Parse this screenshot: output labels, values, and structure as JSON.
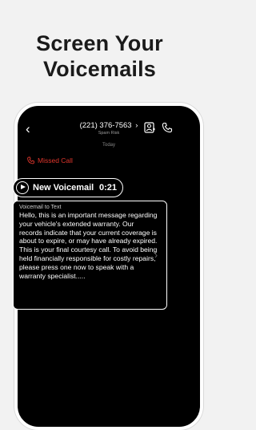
{
  "headline": {
    "line1": "Screen Your",
    "line2": "Voicemails"
  },
  "header": {
    "back_icon": "chevron-left-icon",
    "phone_number": "(221) 376-7563",
    "chevron_icon": "chevron-right-icon",
    "subtitle": "Spam Risk",
    "contact_icon": "contact-card-icon",
    "call_icon": "phone-icon"
  },
  "thread": {
    "date_label": "Today",
    "missed_call_label": "Missed Call",
    "missed_call_color": "#e0362c"
  },
  "voicemail": {
    "label": "New Voicemail",
    "duration": "0:21",
    "play_icon": "play-icon"
  },
  "transcript": {
    "label": "Voicemail to Text",
    "text": "Hello, this is an important message regarding your vehicle's extended warranty. Our records indicate that your current coverage is about to expire, or may have already expired. This is your final courtesy call. To avoid being held financially responsible for costly repairs, please press one now to speak with a warranty specialist.....",
    "expand_icon": "chevron-right-icon"
  }
}
